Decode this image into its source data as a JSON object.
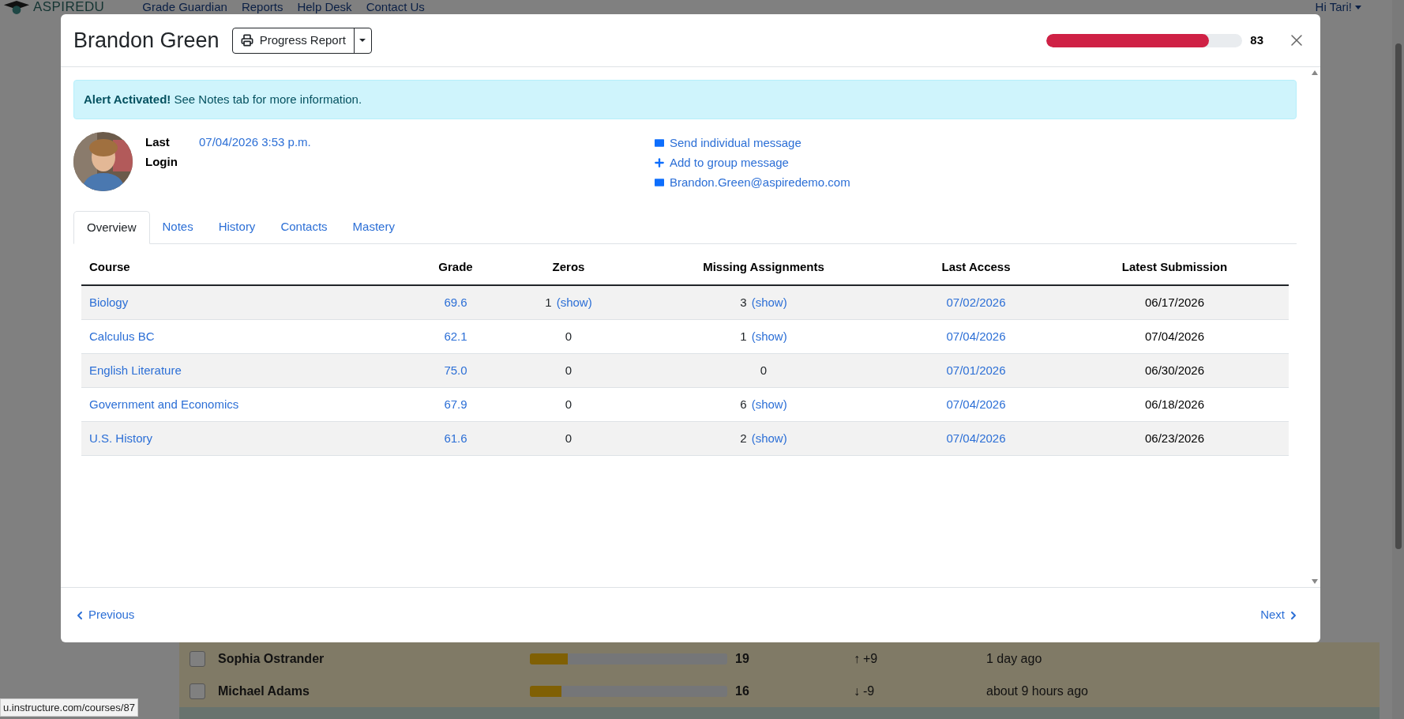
{
  "navbar": {
    "logo": "ASPIREDU",
    "links": [
      "Grade Guardian",
      "Reports",
      "Help Desk",
      "Contact Us"
    ],
    "user_menu": "Hi Tari!"
  },
  "background_rows": [
    {
      "name": "Sophia Ostrander",
      "color": "#807a66",
      "level": 0.19,
      "score": "19",
      "arrow": "↑",
      "change": "+9",
      "last_seen": "1 day ago"
    },
    {
      "name": "Michael Adams",
      "color": "#807a66",
      "level": 0.16,
      "score": "16",
      "arrow": "↓",
      "change": "-9",
      "last_seen": "about 9 hours ago"
    },
    {
      "color": "#68736e"
    }
  ],
  "status_bar": "u.instructure.com/courses/87",
  "modal": {
    "title": "Brandon Green",
    "report_button": "Progress Report",
    "score": {
      "level": 0.83,
      "reading": "83"
    },
    "alert": "**Alert Activated!** See Notes tab for more information.",
    "last_login": {
      "label": "Last Login",
      "value": "07/04/2026 3:53 p.m."
    },
    "actions": [
      {
        "kind": "message",
        "label": "Send individual message"
      },
      {
        "kind": "add",
        "label": "Add to group message"
      },
      {
        "kind": "email",
        "label": "Brandon.Green@aspiredemo.com"
      }
    ],
    "tabs": [
      {
        "label": "Overview",
        "selected": true
      },
      {
        "label": "Notes",
        "selected": false
      },
      {
        "label": "History",
        "selected": false
      },
      {
        "label": "Contacts",
        "selected": false
      },
      {
        "label": "Mastery",
        "selected": false
      }
    ],
    "table": {
      "columns": [
        "Course",
        "Grade",
        "Zeros",
        "Missing Assignments",
        "Last Access",
        "Latest Submission"
      ],
      "rows": [
        {
          "course": "Biology",
          "grade": "69.6",
          "zeros": {
            "count": "1",
            "link": "(show)"
          },
          "missing": {
            "count": "3",
            "link": "(show)"
          },
          "last_access": "07/02/2026",
          "latest_submission": "06/17/2026"
        },
        {
          "course": "Calculus BC",
          "grade": "62.1",
          "zeros": {
            "count": "0"
          },
          "missing": {
            "count": "1",
            "link": "(show)"
          },
          "last_access": "07/04/2026",
          "latest_submission": "07/04/2026"
        },
        {
          "course": "English Literature",
          "grade": "75.0",
          "zeros": {
            "count": "0"
          },
          "missing": {
            "count": "0"
          },
          "last_access": "07/01/2026",
          "latest_submission": "06/30/2026"
        },
        {
          "course": "Government and Economics",
          "grade": "67.9",
          "zeros": {
            "count": "0"
          },
          "missing": {
            "count": "6",
            "link": "(show)"
          },
          "last_access": "07/04/2026",
          "latest_submission": "06/18/2026"
        },
        {
          "course": "U.S. History",
          "grade": "61.6",
          "zeros": {
            "count": "0"
          },
          "missing": {
            "count": "2",
            "link": "(show)"
          },
          "last_access": "07/04/2026",
          "latest_submission": "06/23/2026"
        }
      ]
    },
    "footer": {
      "previous": "Previous",
      "next": "Next"
    }
  }
}
